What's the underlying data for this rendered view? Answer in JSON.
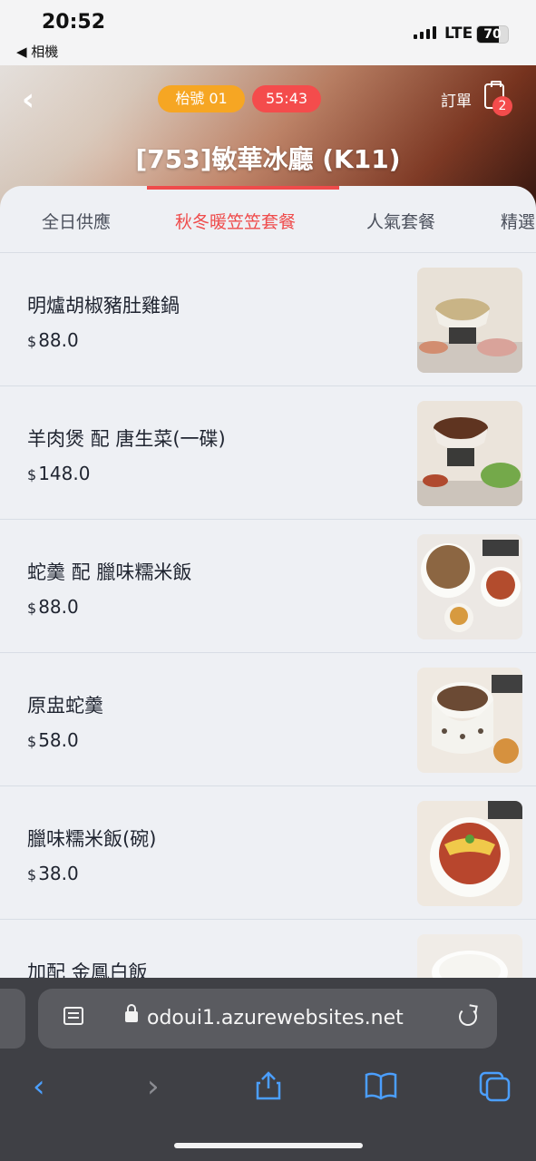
{
  "status_bar": {
    "time": "20:52",
    "back_app": "◀ 相機",
    "network": "LTE",
    "battery": "70",
    "battery_level": 0.7
  },
  "header": {
    "back_icon": "chevron-left-icon",
    "table_pill": "枱號  01",
    "timer_pill": "55:43",
    "order_label": "訂單",
    "order_count": "2",
    "store_title": "[753]敏華冰廳 (K11)"
  },
  "tabs": [
    {
      "label": "全日供應",
      "active": false
    },
    {
      "label": "秋冬暖笠笠套餐",
      "active": true
    },
    {
      "label": "人氣套餐",
      "active": false
    },
    {
      "label": "精選",
      "active": false
    }
  ],
  "menu": {
    "currency": "$",
    "items": [
      {
        "name": "明爐胡椒豬肚雞鍋",
        "price": "88.0"
      },
      {
        "name": "羊肉煲 配 唐生菜(一碟)",
        "price": "148.0"
      },
      {
        "name": "蛇羹 配 臘味糯米飯",
        "price": "88.0"
      },
      {
        "name": "原盅蛇羹",
        "price": "58.0"
      },
      {
        "name": "臘味糯米飯(碗)",
        "price": "38.0"
      },
      {
        "name": "加配 金鳳白飯",
        "price": ""
      }
    ]
  },
  "browser": {
    "url": "odoui1.azurewebsites.net",
    "accent": "#4b9fff"
  }
}
